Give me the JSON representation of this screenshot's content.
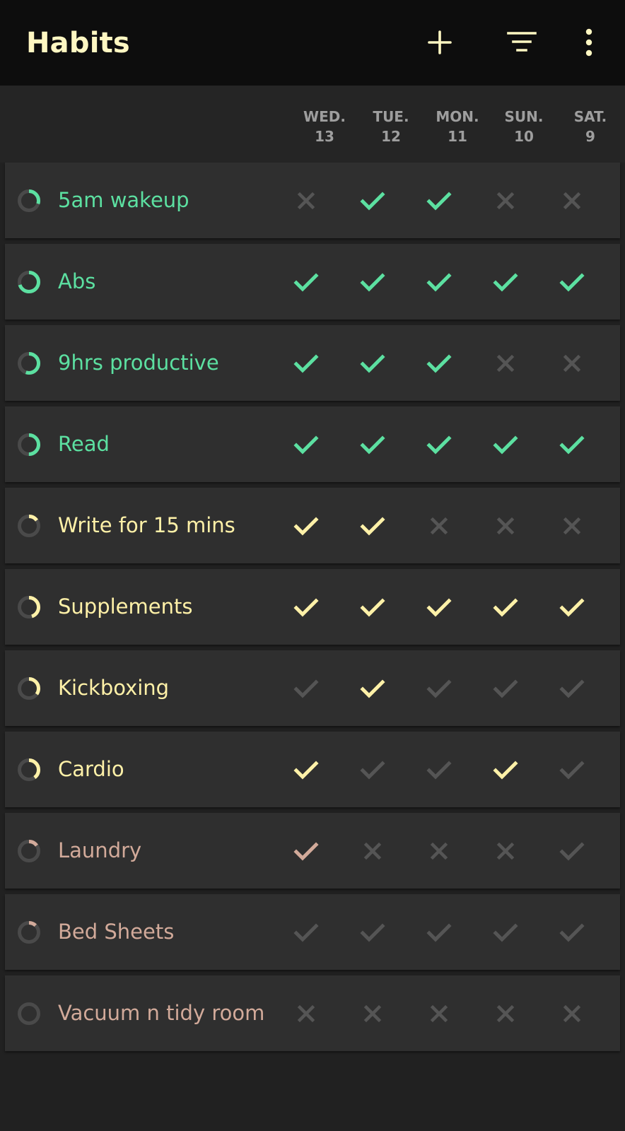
{
  "app": {
    "title": "Habits"
  },
  "icons": {
    "add": "plus-icon",
    "filter": "filter-icon",
    "more": "more-vertical-icon"
  },
  "colors": {
    "green": "#5ce0a1",
    "yellow": "#fff1a8",
    "peach": "#d2aa9a",
    "muted": "#555555",
    "ringTrack": "#4a4a4a"
  },
  "days": [
    {
      "weekday": "WED.",
      "date": "13"
    },
    {
      "weekday": "TUE.",
      "date": "12"
    },
    {
      "weekday": "MON.",
      "date": "11"
    },
    {
      "weekday": "SUN.",
      "date": "10"
    },
    {
      "weekday": "SAT.",
      "date": "9"
    }
  ],
  "habits": [
    {
      "name": "5am wakeup",
      "color": "#5ce0a1",
      "progress": 0.3,
      "marks": [
        "x",
        "check",
        "check",
        "x",
        "x"
      ]
    },
    {
      "name": "Abs",
      "color": "#5ce0a1",
      "progress": 0.7,
      "marks": [
        "check",
        "check",
        "check",
        "check",
        "check"
      ]
    },
    {
      "name": "9hrs productive",
      "color": "#5ce0a1",
      "progress": 0.55,
      "marks": [
        "check",
        "check",
        "check",
        "x",
        "x"
      ]
    },
    {
      "name": "Read",
      "color": "#5ce0a1",
      "progress": 0.5,
      "marks": [
        "check",
        "check",
        "check",
        "check",
        "check"
      ]
    },
    {
      "name": "Write for 15 mins",
      "color": "#fff1a8",
      "progress": 0.15,
      "marks": [
        "check",
        "check",
        "x",
        "x",
        "x"
      ]
    },
    {
      "name": "Supplements",
      "color": "#fff1a8",
      "progress": 0.45,
      "marks": [
        "check",
        "check",
        "check",
        "check",
        "check"
      ]
    },
    {
      "name": "Kickboxing",
      "color": "#fff1a8",
      "progress": 0.35,
      "marks": [
        "dim-check",
        "check",
        "dim-check",
        "dim-check",
        "dim-check"
      ]
    },
    {
      "name": "Cardio",
      "color": "#fff1a8",
      "progress": 0.4,
      "marks": [
        "check",
        "dim-check",
        "dim-check",
        "check",
        "dim-check"
      ]
    },
    {
      "name": "Laundry",
      "color": "#d2aa9a",
      "progress": 0.15,
      "marks": [
        "check",
        "x",
        "x",
        "x",
        "dim-check"
      ]
    },
    {
      "name": "Bed Sheets",
      "color": "#d2aa9a",
      "progress": 0.12,
      "marks": [
        "dim-check",
        "dim-check",
        "dim-check",
        "dim-check",
        "dim-check"
      ]
    },
    {
      "name": "Vacuum n tidy room",
      "color": "#d2aa9a",
      "progress": 0.0,
      "marks": [
        "x",
        "x",
        "x",
        "x",
        "x"
      ]
    }
  ]
}
